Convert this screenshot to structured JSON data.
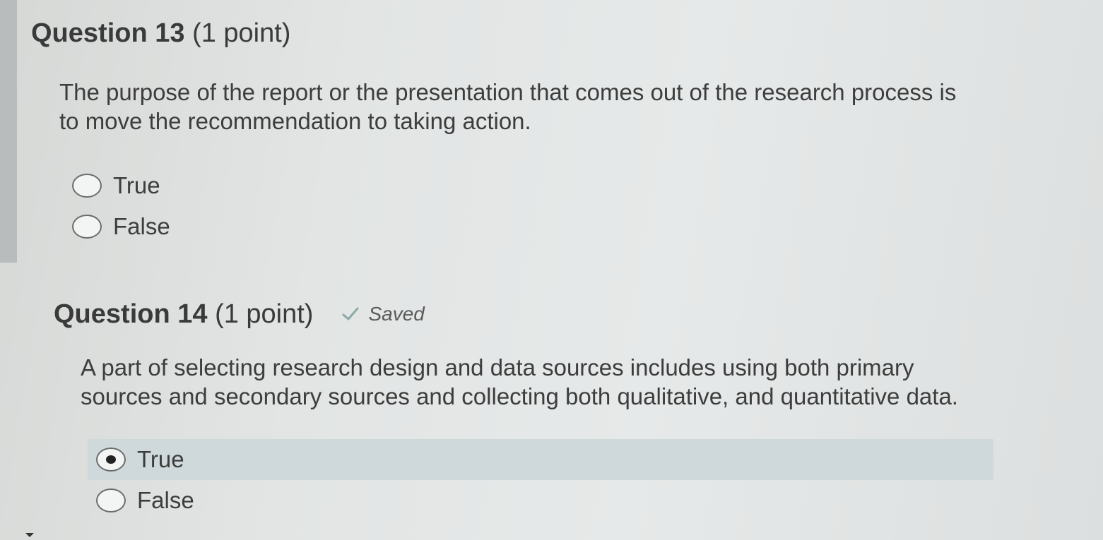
{
  "questions": [
    {
      "label": "Question 13",
      "points": "(1 point)",
      "status": "",
      "text": "The purpose of the report or the presentation that comes out of the research process is to move the recommendation to taking action.",
      "options": [
        {
          "label": "True",
          "selected": false
        },
        {
          "label": "False",
          "selected": false
        }
      ]
    },
    {
      "label": "Question 14",
      "points": "(1 point)",
      "status": "Saved",
      "status_icon": "check-icon",
      "text": "A part of selecting research design and data sources includes using both primary sources and secondary sources and collecting both qualitative, and quantitative data.",
      "options": [
        {
          "label": "True",
          "selected": true
        },
        {
          "label": "False",
          "selected": false
        }
      ]
    }
  ],
  "colors": {
    "selected_row": "#cfd9dc",
    "text": "#3d3d3d",
    "check": "#8fa8a8"
  }
}
